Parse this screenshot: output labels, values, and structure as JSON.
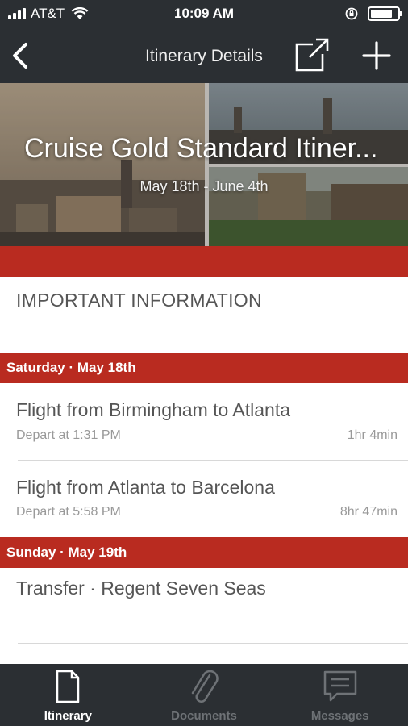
{
  "status_bar": {
    "carrier": "AT&T",
    "time": "10:09 AM"
  },
  "nav": {
    "title": "Itinerary Details",
    "icons": [
      "chevron-left-icon",
      "share-icon",
      "plus-icon"
    ]
  },
  "hero": {
    "title": "Cruise Gold Standard Itiner...",
    "dates": "May 18th - June 4th"
  },
  "important": {
    "label": "IMPORTANT INFORMATION"
  },
  "days": [
    {
      "header": "Saturday · May 18th",
      "items": [
        {
          "title": "Flight from Birmingham to Atlanta",
          "subtitle": "Depart at 1:31 PM",
          "duration": "1hr 4min"
        },
        {
          "title": "Flight from Atlanta to Barcelona",
          "subtitle": "Depart at 5:58 PM",
          "duration": "8hr 47min"
        }
      ]
    },
    {
      "header": "Sunday · May 19th",
      "items": [
        {
          "title": "Transfer · Regent Seven Seas"
        }
      ]
    }
  ],
  "tabs": [
    {
      "label": "Itinerary",
      "icon": "document-icon",
      "active": true
    },
    {
      "label": "Documents",
      "icon": "paperclip-icon",
      "active": false
    },
    {
      "label": "Messages",
      "icon": "message-icon",
      "active": false
    }
  ],
  "colors": {
    "bar": "#2b2f33",
    "accent_red": "#b92b20"
  }
}
